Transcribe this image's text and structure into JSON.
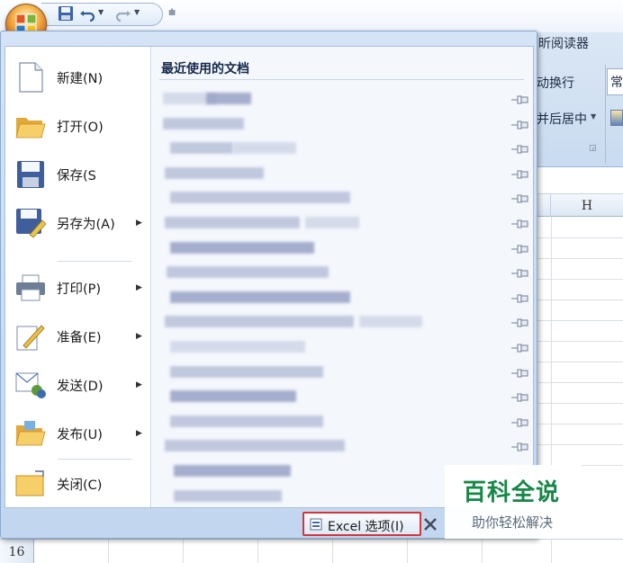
{
  "ribbon": {
    "tab_partial": "昕阅读器",
    "wrap_text_partial": "动换行",
    "number_format_partial": "常",
    "merge_center_partial": "并后居中"
  },
  "sheet": {
    "column_header": "H",
    "row_number": "16"
  },
  "office_menu": {
    "items": [
      {
        "label": "新建(N)",
        "icon": "new-document-icon",
        "has_submenu": false
      },
      {
        "label": "打开(O)",
        "icon": "open-folder-icon",
        "has_submenu": false
      },
      {
        "label": "保存(S",
        "icon": "save-floppy-icon",
        "has_submenu": false
      },
      {
        "label": "另存为(A)",
        "icon": "save-as-icon",
        "has_submenu": true
      },
      {
        "label": "打印(P)",
        "icon": "printer-icon",
        "has_submenu": true
      },
      {
        "label": "准备(E)",
        "icon": "prepare-pencil-icon",
        "has_submenu": true
      },
      {
        "label": "发送(D)",
        "icon": "send-icon",
        "has_submenu": true
      },
      {
        "label": "发布(U)",
        "icon": "publish-folder-icon",
        "has_submenu": true
      },
      {
        "label": "关闭(C)",
        "icon": "close-folder-icon",
        "has_submenu": false
      }
    ],
    "recent_title": "最近使用的文档",
    "recent_count": 17,
    "excel_options_label": "Excel 选项(I)"
  },
  "watermark": {
    "title": "百科全说",
    "subtitle": "助你轻松解决"
  },
  "colors": {
    "menu_border": "#8ba8cf",
    "highlight_box": "#d2363b",
    "watermark_green": "#168747"
  }
}
